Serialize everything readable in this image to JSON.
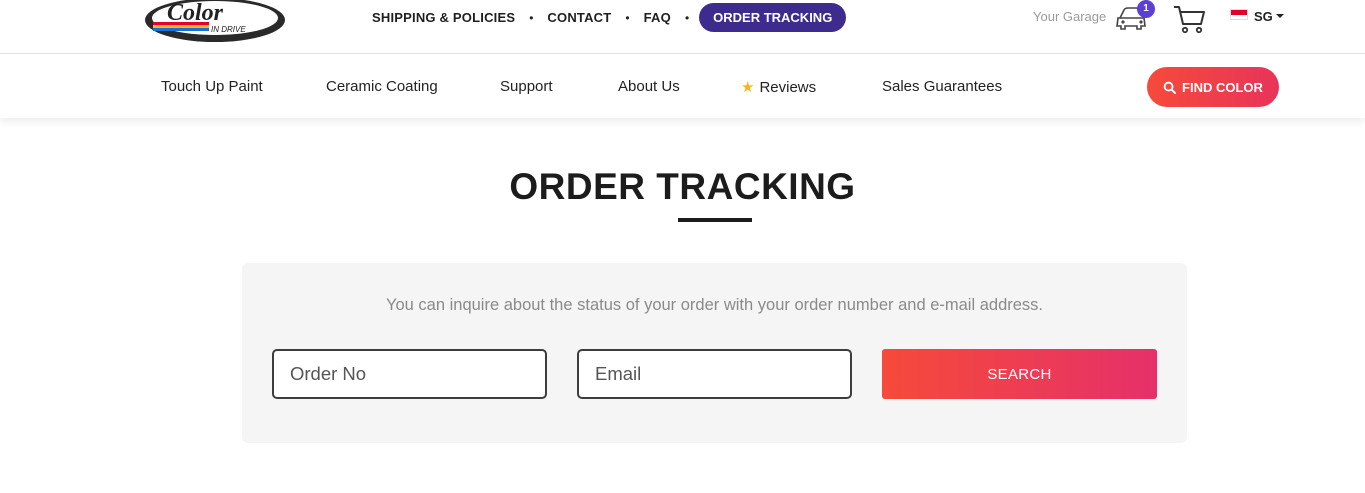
{
  "header": {
    "logo": {
      "text": "Color",
      "subtext": "IN DRIVE"
    },
    "top_links": [
      {
        "label": "SHIPPING & POLICIES"
      },
      {
        "label": "CONTACT"
      },
      {
        "label": "FAQ"
      }
    ],
    "separator": "•",
    "order_tracking_label": "ORDER TRACKING",
    "garage_label": "Your Garage",
    "garage_count": "1",
    "language": "SG"
  },
  "nav": {
    "items": [
      {
        "label": "Touch Up Paint"
      },
      {
        "label": "Ceramic Coating"
      },
      {
        "label": "Support"
      },
      {
        "label": "About Us"
      },
      {
        "label": "Reviews"
      },
      {
        "label": "Sales Guarantees"
      }
    ],
    "find_color_label": "FIND COLOR"
  },
  "page": {
    "title": "ORDER TRACKING",
    "description": "You can inquire about the status of your order with your order number and e-mail address.",
    "order_placeholder": "Order No",
    "email_placeholder": "Email",
    "search_label": "SEARCH"
  },
  "colors": {
    "accent_purple": "#3d2c8d",
    "accent_red": "#f64a3a",
    "accent_pink": "#e5306a"
  }
}
